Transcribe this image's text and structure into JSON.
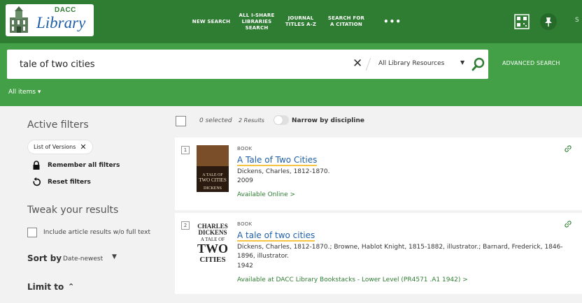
{
  "header": {
    "logo_top": "DACC",
    "logo_main": "Library",
    "nav": [
      "NEW SEARCH",
      "ALL I-SHARE\nLIBRARIES\nSEARCH",
      "JOURNAL\nTITLES A-Z",
      "SEARCH FOR\nA CITATION",
      "•••"
    ],
    "cut_text": "S"
  },
  "search": {
    "query": "tale of two cities",
    "clear": "✕",
    "scope": "All Library Resources",
    "advanced": "ADVANCED SEARCH",
    "all_items": "All items ▾"
  },
  "sidebar": {
    "active_filters_title": "Active filters",
    "chip_label": "List of Versions",
    "chip_x": "✕",
    "remember": "Remember all filters",
    "reset": "Reset filters",
    "tweak_title": "Tweak your results",
    "include_label": "Include article results w/o full text",
    "sort_label": "Sort by",
    "sort_value": "Date-newest",
    "limit_label": "Limit to"
  },
  "results_bar": {
    "selected": "0 selected",
    "count": "2 Results",
    "narrow": "Narrow by discipline"
  },
  "results": [
    {
      "num": "1",
      "type": "BOOK",
      "title": "A Tale of Two Cities",
      "author": "Dickens, Charles, 1812-1870.",
      "year": "2009",
      "availability": "Available Online  >"
    },
    {
      "num": "2",
      "type": "BOOK",
      "title": "A tale of two cities",
      "author": "Dickens, Charles, 1812-1870.; Browne, Hablot Knight, 1815-1882, illustrator.; Barnard, Frederick, 1846-1896, illustrator.",
      "year": "1942",
      "availability": "Available at DACC Library  Bookstacks - Lower Level (PR4571 .A1 1942)  >"
    }
  ],
  "colors": {
    "nav_green": "#2e7d32",
    "search_green": "#43a047",
    "link_blue": "#1f5fa8",
    "highlight": "#f5c542"
  }
}
